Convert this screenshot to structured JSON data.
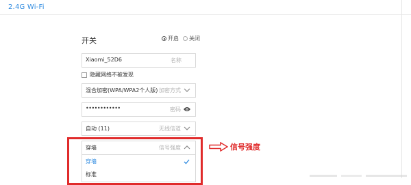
{
  "section": {
    "title": "2.4G Wi-Fi"
  },
  "switch": {
    "label": "开关",
    "options": [
      "开启",
      "关闭"
    ],
    "selected": "开启"
  },
  "ssid": {
    "value": "Xiaomi_52D6",
    "hint": "名称"
  },
  "hide_network": {
    "label": "隐藏网络不被发现",
    "checked": false
  },
  "encryption": {
    "value": "混合加密(WPA/WPA2个人版)",
    "hint": "加密方式"
  },
  "password": {
    "value": "••••••••••••",
    "hint": "密码"
  },
  "channel": {
    "value": "自动 (11)",
    "hint": "无线信道"
  },
  "signal": {
    "value": "穿墙",
    "hint": "信号强度",
    "options": [
      "穿墙",
      "标准"
    ],
    "selected": "穿墙"
  },
  "annotation": {
    "label": "信号强度"
  },
  "colors": {
    "accent": "#2f8be0",
    "highlight": "#e02b2b",
    "border": "#d9d9d9"
  },
  "icons": [
    "radio-icon",
    "checkbox-icon",
    "chevron-down-icon",
    "eye-icon",
    "chevron-up-icon",
    "checkmark-icon",
    "arrow-right-icon"
  ]
}
